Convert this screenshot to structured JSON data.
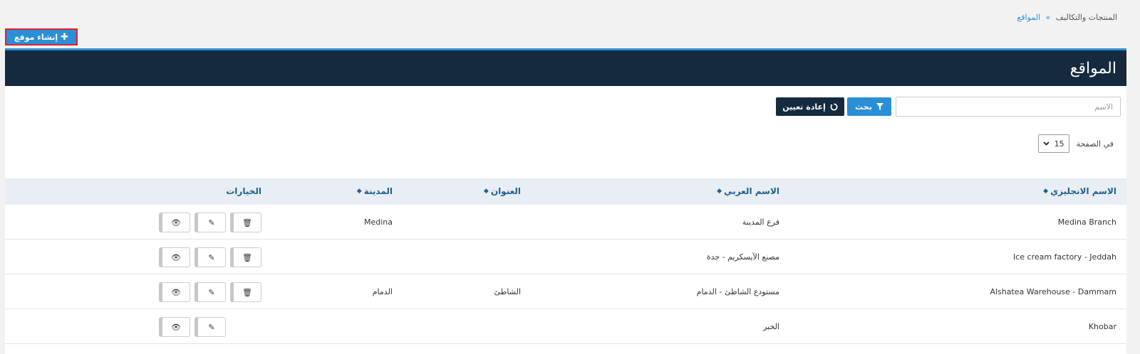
{
  "breadcrumb": {
    "parent": "المنتجات والتكاليف",
    "separator": "»",
    "current": "المواقع"
  },
  "create_button": {
    "label": "إنشاء موقع",
    "icon": "plus-icon"
  },
  "panel": {
    "title": "المواقع"
  },
  "filters": {
    "name_placeholder": "الاسم",
    "name_value": "",
    "search_label": "بحث",
    "search_icon": "filter-icon",
    "reset_label": "إعادة تعيين",
    "reset_icon": "refresh-icon"
  },
  "pagination": {
    "per_page_label": "في الصفحة",
    "per_page_value": "15"
  },
  "table": {
    "columns": [
      "الاسم الانجليزي",
      "الاسم العربي",
      "العنوان",
      "المدينة",
      "الخيارات"
    ],
    "rows": [
      {
        "english_name": "Medina Branch",
        "arabic_name": "فرع المدينة",
        "address": "",
        "city": "Medina",
        "can_delete": true
      },
      {
        "english_name": "Ice cream factory - Jeddah",
        "arabic_name": "مصنع الآيسكريم - جدة",
        "address": "",
        "city": "",
        "can_delete": true
      },
      {
        "english_name": "Alshatea Warehouse - Dammam",
        "arabic_name": "مستودع الشاطئ - الدمام",
        "address": "الشاطئ",
        "city": "الدمام",
        "can_delete": true
      },
      {
        "english_name": "Khobar",
        "arabic_name": "الخبر",
        "address": "",
        "city": "",
        "can_delete": false
      }
    ]
  },
  "colors": {
    "accent": "#2a8fd6",
    "header_dark": "#152a3f",
    "table_head_bg": "#e8eef3",
    "highlight_border": "#e3202a"
  }
}
